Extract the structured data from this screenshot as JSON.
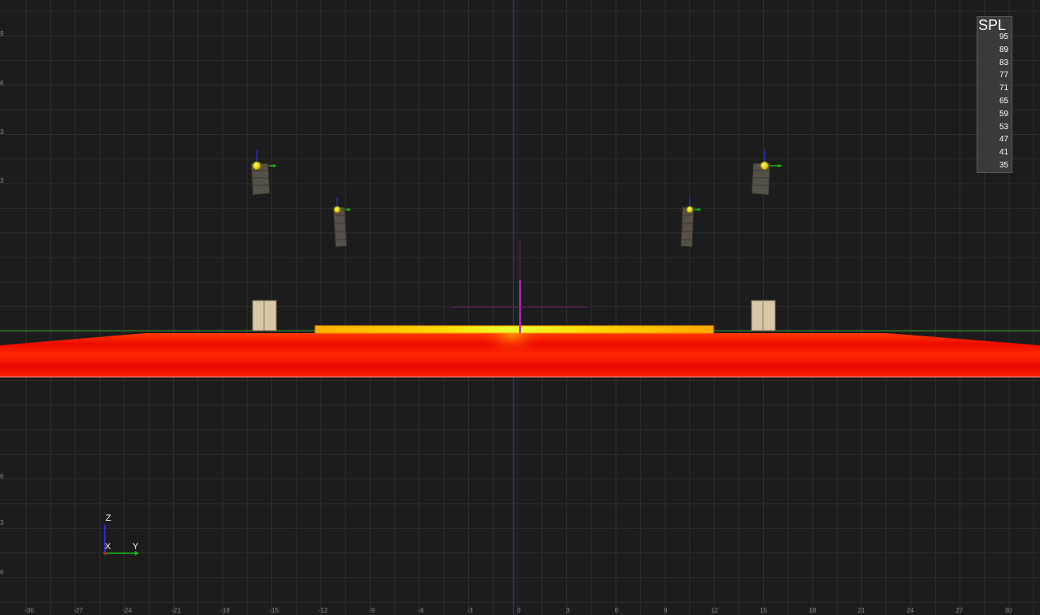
{
  "legend": {
    "title": "SPL",
    "ticks": [
      "95",
      "89",
      "83",
      "77",
      "71",
      "65",
      "59",
      "53",
      "47",
      "41",
      "35"
    ],
    "gradient": [
      "#ffffff",
      "#c80000",
      "#ff2200",
      "#ff8800",
      "#ffee00",
      "#88ff00",
      "#00ff88",
      "#00ccff",
      "#0066ff",
      "#0000cc",
      "#000055"
    ]
  },
  "x_axis_ticks": [
    "-30",
    "-27",
    "-24",
    "-21",
    "-18",
    "-15",
    "-12",
    "-9",
    "-6",
    "-3",
    "0",
    "3",
    "6",
    "9",
    "12",
    "15",
    "18",
    "21",
    "24",
    "27",
    "30"
  ],
  "left_ticks": [
    "9",
    "6",
    "3",
    "3",
    "6",
    "3",
    "6"
  ],
  "gizmo": {
    "z_label": "Z",
    "x_label": "X",
    "y_label": "Y"
  },
  "colors": {
    "background": "#1c1c1c",
    "grid": "#2e2e2e",
    "horizon": "#2aa02a",
    "center_axis": "#4040a0",
    "stage_marker": "#c020c0",
    "speaker_body": "#555048",
    "speaker_source": "#ffe400",
    "subwoofer": "#d8c8a8",
    "spl_hot": "#ff1a00",
    "spl_warm": "#ffd000"
  },
  "speakers": [
    {
      "id": "main-left"
    },
    {
      "id": "side-left"
    },
    {
      "id": "side-right"
    },
    {
      "id": "main-right"
    }
  ],
  "subwoofers": [
    {
      "id": "sub-left"
    },
    {
      "id": "sub-right"
    }
  ]
}
